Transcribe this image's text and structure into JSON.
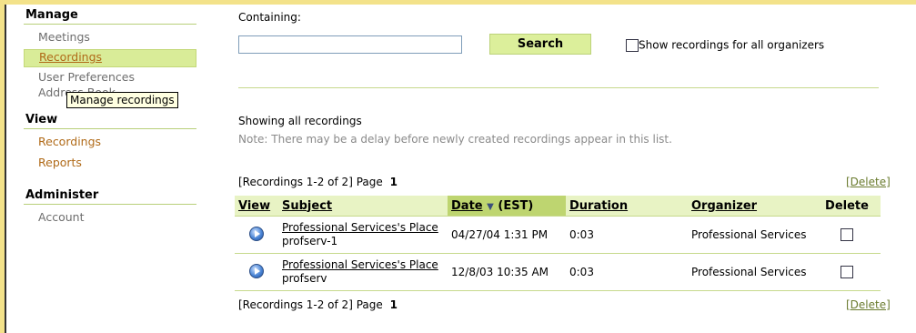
{
  "sidebar": {
    "manage": {
      "title": "Manage",
      "items": [
        "Meetings",
        "Recordings",
        "User Preferences",
        "Address Book"
      ]
    },
    "view": {
      "title": "View",
      "items": [
        "Recordings",
        "Reports"
      ]
    },
    "administer": {
      "title": "Administer",
      "items": [
        "Account"
      ]
    },
    "tooltip": "Manage recordings"
  },
  "search": {
    "label": "Containing:",
    "value": "",
    "button": "Search",
    "checkbox_label": "Show recordings for all organizers",
    "checkbox_checked": false
  },
  "status": {
    "showing": "Showing all recordings",
    "note": "Note: There may be a delay before newly created recordings appear in this list."
  },
  "pager": {
    "text": "[Recordings 1-2 of 2] Page",
    "page": "1",
    "delete_link": "[Delete]"
  },
  "table": {
    "headers": {
      "view": "View",
      "subject": "Subject",
      "date": "Date",
      "date_suffix": "(EST)",
      "duration": "Duration",
      "organizer": "Organizer",
      "delete": "Delete"
    },
    "sort_icon": "sort-desc-icon",
    "rows": [
      {
        "subject_link": "Professional Services's Place",
        "subject_sub": "profserv-1",
        "date": "04/27/04 1:31 PM",
        "duration": "0:03",
        "organizer": "Professional Services"
      },
      {
        "subject_link": "Professional Services's Place",
        "subject_sub": "profserv",
        "date": "12/8/03 10:35 AM",
        "duration": "0:03",
        "organizer": "Professional Services"
      }
    ]
  }
}
